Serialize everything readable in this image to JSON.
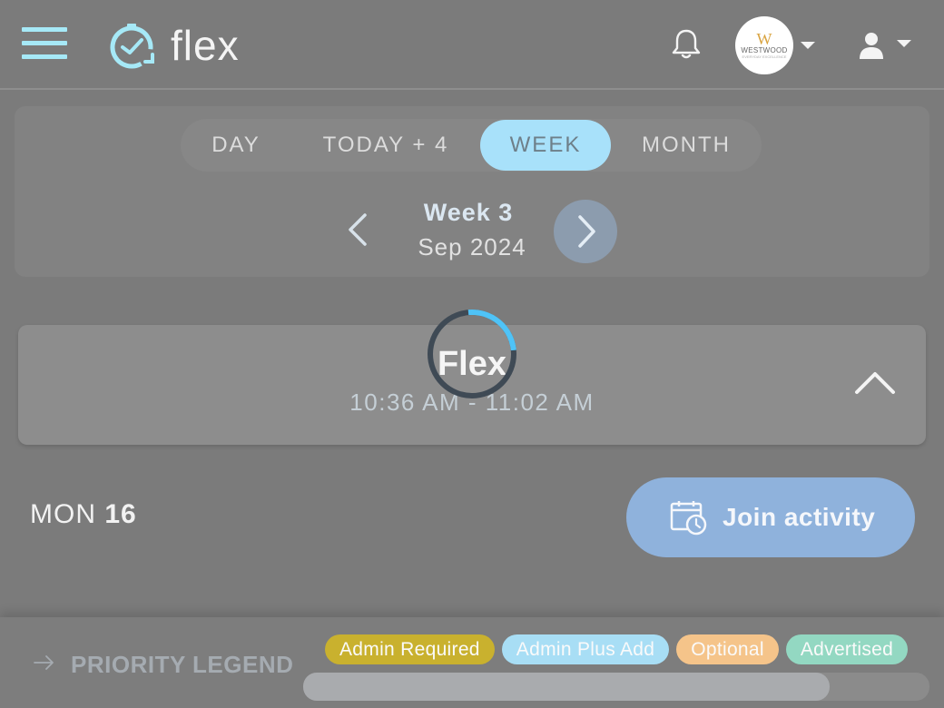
{
  "header": {
    "logo_text": "flex",
    "org": {
      "initial": "W",
      "name": "WESTWOOD",
      "tagline": "EVERYDAY EXCELLENCE"
    }
  },
  "period": {
    "tabs": [
      {
        "label": "DAY"
      },
      {
        "label": "TODAY + 4"
      },
      {
        "label": "WEEK",
        "selected": true
      },
      {
        "label": "MONTH"
      }
    ],
    "week_title": "Week 3",
    "week_subtitle": "Sep 2024"
  },
  "activity": {
    "title": "Flex",
    "time": "10:36 AM - 11:02 AM",
    "loading": true
  },
  "day": {
    "weekday": "MON",
    "date": "16",
    "join_label": "Join activity"
  },
  "legend": {
    "label": "PRIORITY LEGEND",
    "chips": [
      {
        "label": "Admin Required",
        "color": "#c9b12e"
      },
      {
        "label": "Admin Plus Add",
        "color": "#a8def5"
      },
      {
        "label": "Optional",
        "color": "#f5c48a"
      },
      {
        "label": "Advertised",
        "color": "#93d8c2"
      }
    ],
    "scroll_fraction": 0.84
  },
  "colors": {
    "accent": "#a6e9f7",
    "selected_tab": "#a8e1fa",
    "join_button": "#8fb2dc",
    "background": "#7b7b7b"
  }
}
